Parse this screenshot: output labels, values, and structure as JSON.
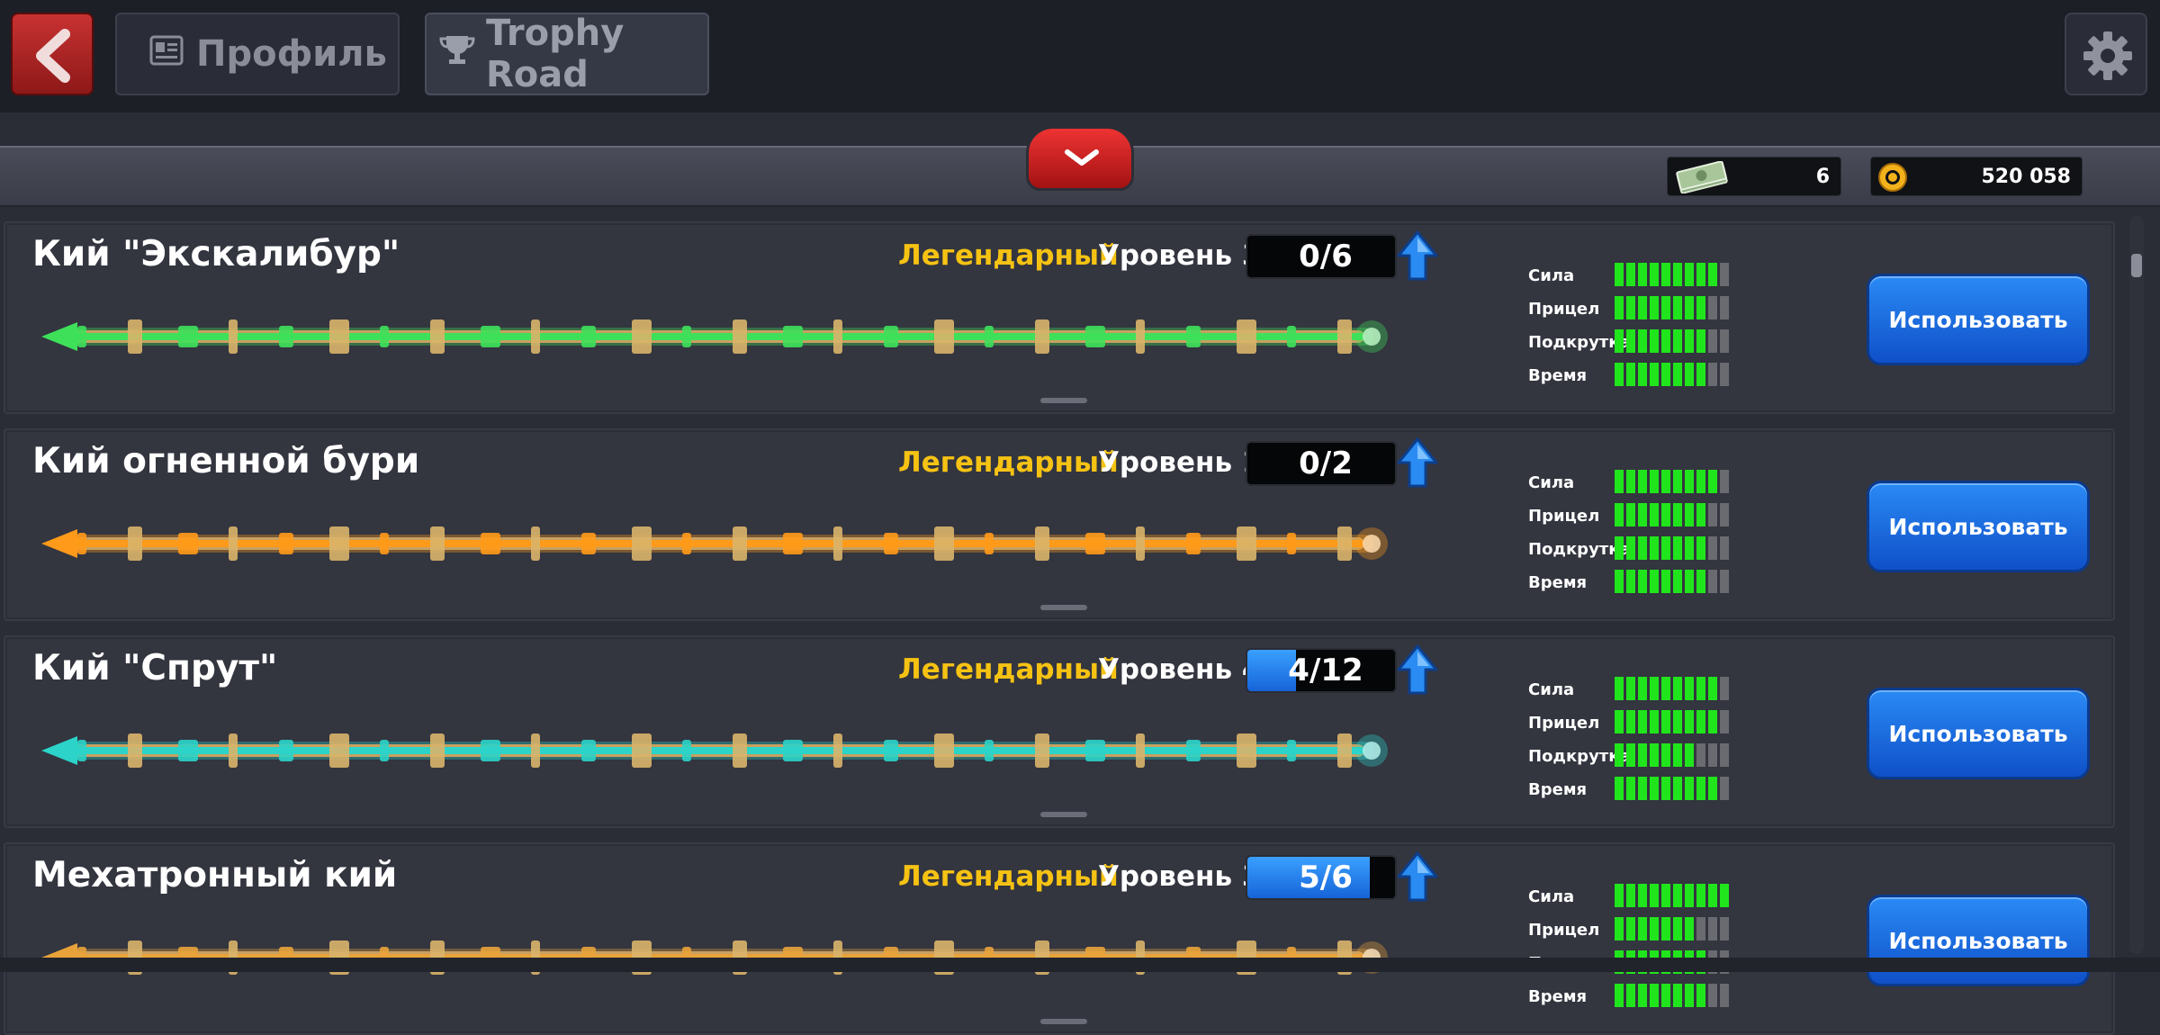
{
  "header": {
    "back_label": "back",
    "tabs": [
      {
        "label": "Профиль",
        "icon": "profile-card-icon"
      },
      {
        "label": "Trophy Road",
        "icon": "trophy-icon"
      }
    ],
    "settings_icon": "gear-icon"
  },
  "currency": {
    "cash": {
      "value": "6",
      "icon": "cash-icon"
    },
    "coins": {
      "value": "520 058",
      "icon": "coin-icon"
    }
  },
  "stat_labels": [
    "Сила",
    "Прицел",
    "Подкрутка",
    "Время"
  ],
  "cues": [
    {
      "name": "Кий \"Экскалибур\"",
      "rarity": "Легендарный",
      "level": "Уровень 3",
      "progress_text": "0/6",
      "progress": 0.0,
      "stats": [
        9,
        8,
        8,
        8
      ],
      "button": "Использовать",
      "theme": "#3ee05a"
    },
    {
      "name": "Кий огненной бури",
      "rarity": "Легендарный",
      "level": "Уровень 1",
      "progress_text": "0/2",
      "progress": 0.0,
      "stats": [
        9,
        8,
        8,
        8
      ],
      "button": "Использовать",
      "theme": "#ff9a1a"
    },
    {
      "name": "Кий \"Спрут\"",
      "rarity": "Легендарный",
      "level": "Уровень 4",
      "progress_text": "4/12",
      "progress": 0.33,
      "stats": [
        9,
        9,
        7,
        9
      ],
      "button": "Использовать",
      "theme": "#2bd3c8"
    },
    {
      "name": "Мехатронный кий",
      "rarity": "Легендарный",
      "level": "Уровень 3",
      "progress_text": "5/6",
      "progress": 0.83,
      "stats": [
        10,
        7,
        8,
        8
      ],
      "button": "Использовать",
      "theme": "#e8a23a"
    }
  ]
}
